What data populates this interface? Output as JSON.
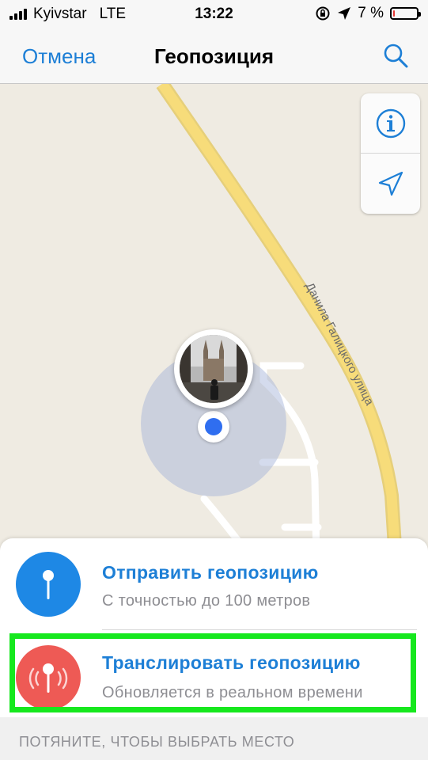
{
  "status_bar": {
    "carrier": "Kyivstar",
    "network": "LTE",
    "time": "13:22",
    "battery_percent": "7 %",
    "battery_level": 0.07,
    "icons": [
      "signal-icon",
      "orientation-lock-icon",
      "location-arrow-icon",
      "battery-icon"
    ]
  },
  "nav": {
    "cancel": "Отмена",
    "title": "Геопозиция",
    "search_icon": "search-icon"
  },
  "map": {
    "street_label": "Данила Галицкого улица",
    "controls": [
      "info-icon",
      "location-arrow-icon"
    ],
    "colors": {
      "background": "#efebe2",
      "main_road": "#f7dc7a",
      "accuracy": "#a0afd7",
      "user_dot": "#2f6ef0"
    }
  },
  "actions": [
    {
      "title": "Отправить геопозицию",
      "subtitle": "С точностью до 100 метров",
      "icon": "pin-icon",
      "color": "#1e88e5"
    },
    {
      "title": "Транслировать геопозицию",
      "subtitle": "Обновляется в реальном времени",
      "icon": "live-location-icon",
      "color": "#ee5a55"
    }
  ],
  "footer": {
    "label": "ПОТЯНИТЕ, ЧТОБЫ ВЫБРАТЬ МЕСТО"
  },
  "accent_color": "#1d7fd6",
  "highlight_color": "#16e81e"
}
